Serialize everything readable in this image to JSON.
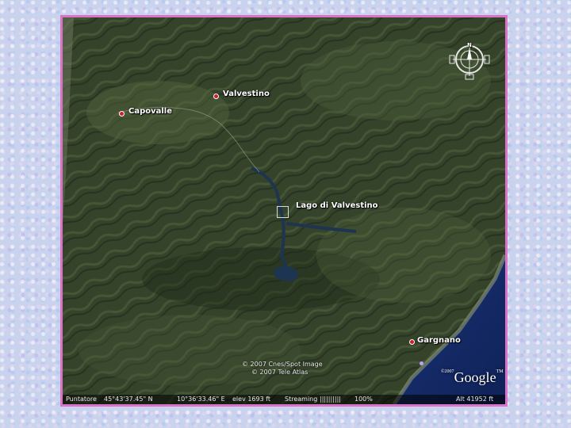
{
  "map": {
    "places": {
      "valvestino": "Valvestino",
      "capovalle": "Capovalle",
      "lago": "Lago di Valvestino",
      "gargnano": "Gargnano"
    },
    "credits": {
      "line1": "© 2007 Cnes/Spot Image",
      "line2": "© 2007 Tele Atlas"
    },
    "logo": {
      "prefix": "©2007",
      "text": "Google",
      "tm": "TM"
    },
    "status": {
      "pointer_label": "Puntatore",
      "latitude": "45°43'37.45\" N",
      "longitude": "10°36'33.46\" E",
      "elevation": "elev  1693 ft",
      "streaming_label": "Streaming",
      "streaming_bar": "||||||||||",
      "streaming_percent": "100%",
      "altitude": "Alt   41952 ft"
    },
    "compass": {
      "north": "N"
    },
    "colors": {
      "frame_border": "#d873c8",
      "pin": "#d21a2a",
      "lake": "#1d3550",
      "sea": "#142a66",
      "terrain": "#3a4a2c"
    }
  }
}
